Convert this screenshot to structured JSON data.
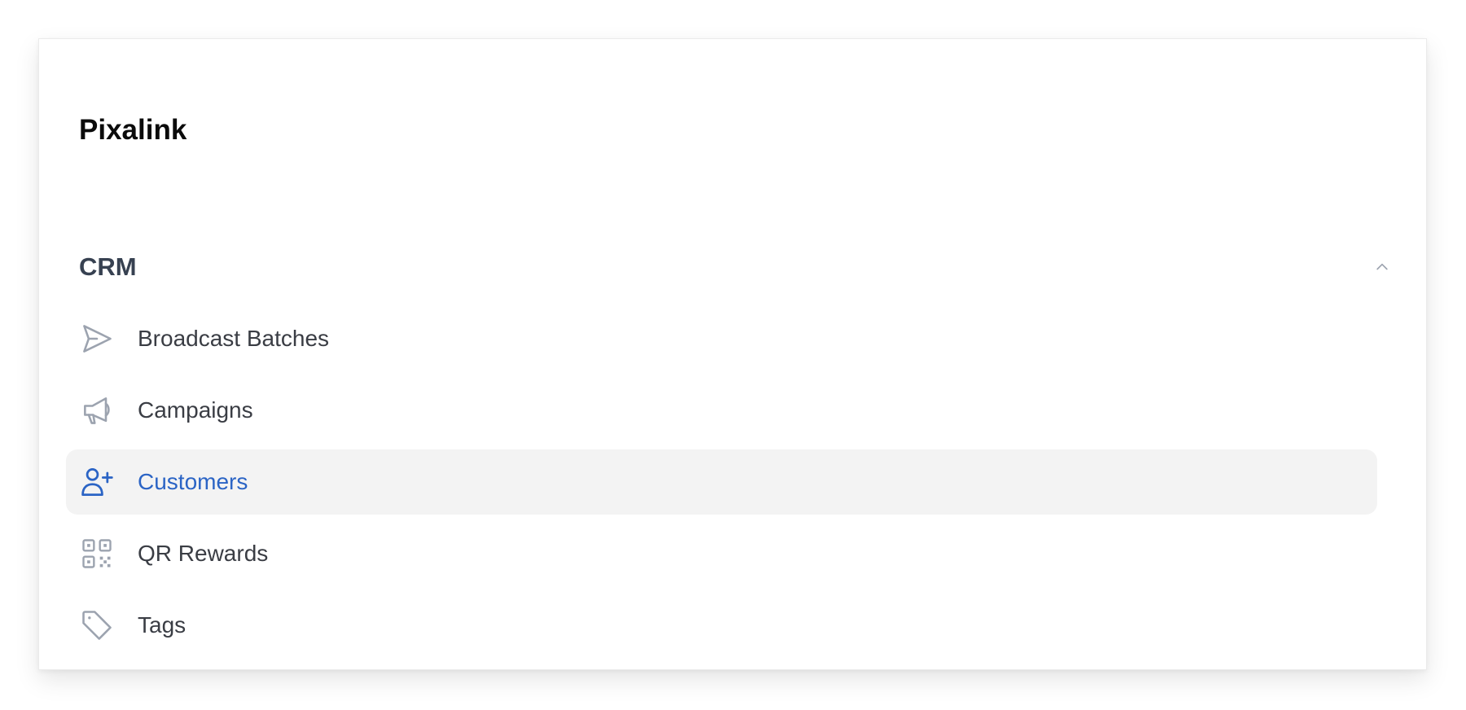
{
  "brand": {
    "name": "Pixalink"
  },
  "section": {
    "title": "CRM",
    "expanded": true,
    "toggle_icon": "chevron-up-icon"
  },
  "nav": {
    "items": [
      {
        "label": "Broadcast Batches",
        "icon": "send-icon",
        "active": false
      },
      {
        "label": "Campaigns",
        "icon": "megaphone-icon",
        "active": false
      },
      {
        "label": "Customers",
        "icon": "user-plus-icon",
        "active": true
      },
      {
        "label": "QR Rewards",
        "icon": "qr-code-icon",
        "active": false
      },
      {
        "label": "Tags",
        "icon": "tag-icon",
        "active": false
      }
    ]
  },
  "colors": {
    "active_text": "#2b64c5",
    "active_bg": "#f3f3f3",
    "icon_gray": "#9ca3af",
    "text": "#3a3d44"
  }
}
